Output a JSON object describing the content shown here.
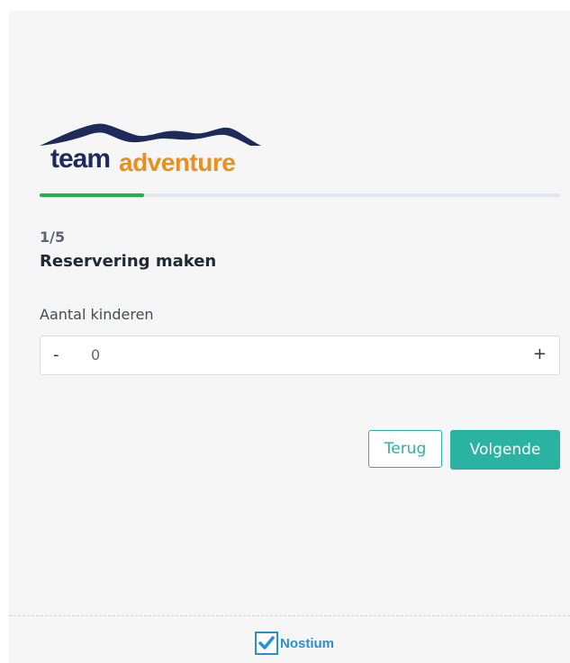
{
  "logo": {
    "word1": "team",
    "word2": "adventure"
  },
  "progress": {
    "fraction": 0.2
  },
  "step": {
    "counter": "1/5",
    "title": "Reservering maken"
  },
  "field": {
    "label": "Aantal kinderen",
    "value": "0",
    "decrement": "-",
    "increment": "+"
  },
  "buttons": {
    "back": "Terug",
    "next": "Volgende"
  },
  "footer": {
    "brand": "Nostium"
  },
  "colors": {
    "accent": "#2ab3a0",
    "progress": "#22b04a",
    "logo_dark": "#1d2a5a",
    "logo_orange": "#e8901a",
    "brand_blue": "#2a8fcf"
  },
  "icons": {
    "brand": "check-icon"
  }
}
